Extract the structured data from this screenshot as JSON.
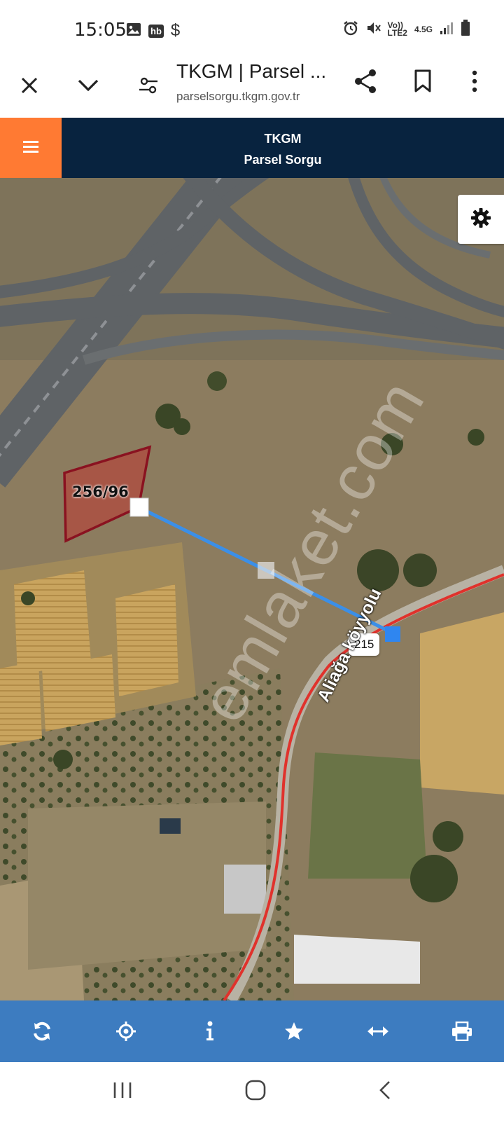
{
  "status": {
    "time": "15:05",
    "left_icons": [
      "image-icon",
      "hb-icon",
      "dollar-icon"
    ],
    "hb_text": "hb",
    "dollar_text": "$",
    "right": {
      "volte_top": "Vo))",
      "volte_bottom": "LTE2",
      "network": "4.5G"
    }
  },
  "browser": {
    "title": "TKGM | Parsel ...",
    "url": "parselsorgu.tkgm.gov.tr"
  },
  "app": {
    "title": "TKGM",
    "subtitle": "Parsel Sorgu",
    "accent": "#ff7a33",
    "header_color": "#08233f"
  },
  "map": {
    "parcel_label": "256/96",
    "distance_label": "215",
    "road_label": "Aliağa köyyolu",
    "watermark": "emlaket.com",
    "parcel_color": "#8a1220",
    "measure_color": "#3b8fe8",
    "road_color": "#e0322c"
  },
  "toolbar": {
    "color": "#3d7cc0",
    "items": [
      "refresh-icon",
      "locate-icon",
      "info-icon",
      "favorite-icon",
      "measure-icon",
      "print-icon"
    ]
  },
  "navbar": {
    "items": [
      "recent-apps-icon",
      "home-icon",
      "back-icon"
    ]
  }
}
